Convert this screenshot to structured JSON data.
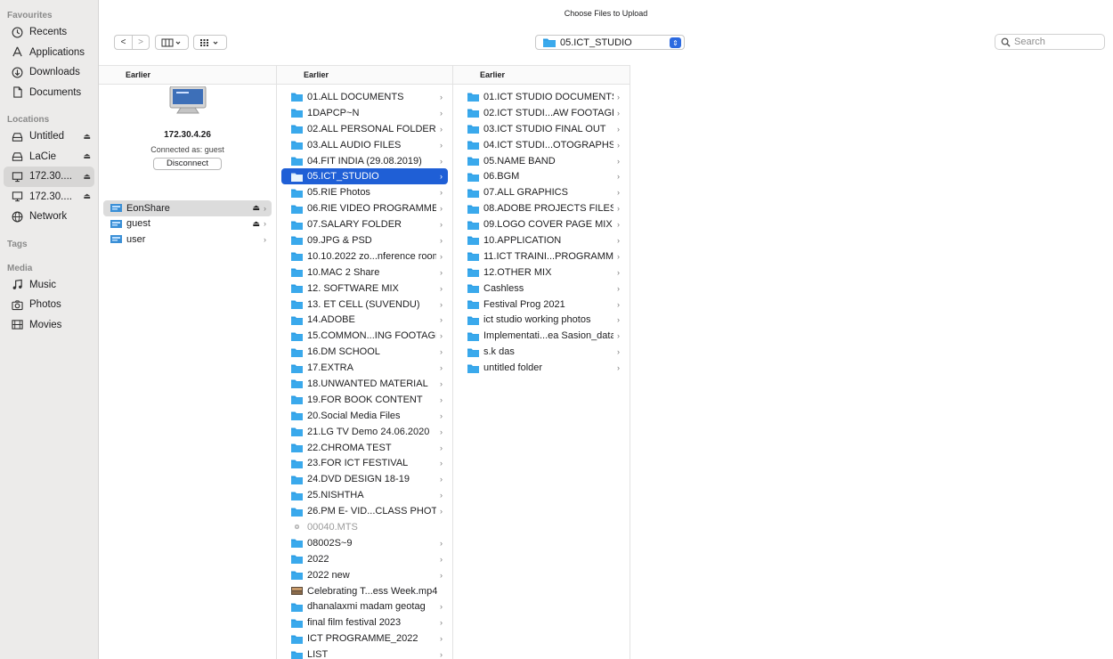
{
  "window": {
    "title": "Choose Files to Upload"
  },
  "sidebar": {
    "favourites_heading": "Favourites",
    "favourites": [
      {
        "label": "Recents",
        "icon": "clock-icon"
      },
      {
        "label": "Applications",
        "icon": "applications-icon"
      },
      {
        "label": "Downloads",
        "icon": "download-icon"
      },
      {
        "label": "Documents",
        "icon": "document-icon"
      }
    ],
    "locations_heading": "Locations",
    "locations": [
      {
        "label": "Untitled",
        "icon": "drive-icon",
        "eject": "⏏"
      },
      {
        "label": "LaCie",
        "icon": "drive-icon",
        "eject": "⏏"
      },
      {
        "label": "172.30....",
        "icon": "server-icon",
        "eject": "⏏",
        "selected": true
      },
      {
        "label": "172.30....",
        "icon": "server-icon",
        "eject": "⏏"
      },
      {
        "label": "Network",
        "icon": "network-icon"
      }
    ],
    "tags_heading": "Tags",
    "media_heading": "Media",
    "media": [
      {
        "label": "Music",
        "icon": "music-icon"
      },
      {
        "label": "Photos",
        "icon": "camera-icon"
      },
      {
        "label": "Movies",
        "icon": "film-icon"
      }
    ]
  },
  "toolbar": {
    "back": "<",
    "forward": ">",
    "view_icon": "columns-view-icon",
    "arrange_icon": "grid-arrange-icon",
    "path": "05.ICT_STUDIO",
    "search_placeholder": "Search"
  },
  "columns": {
    "header": "Earlier",
    "server": {
      "name": "172.30.4.26",
      "connected": "Connected as: guest",
      "disconnect": "Disconnect"
    },
    "shares": [
      {
        "name": "EonShare",
        "eject": "⏏",
        "chev": "›",
        "active": true
      },
      {
        "name": "guest",
        "eject": "⏏",
        "chev": "›"
      },
      {
        "name": "user",
        "chev": "›"
      }
    ],
    "col2": [
      {
        "name": "01.ALL DOCUMENTS",
        "chev": "›"
      },
      {
        "name": "1DAPCP~N",
        "chev": "›"
      },
      {
        "name": "02.ALL PERSONAL FOLDER",
        "chev": "›"
      },
      {
        "name": "03.ALL AUDIO FILES",
        "chev": "›"
      },
      {
        "name": "04.FIT INDIA (29.08.2019)",
        "chev": "›"
      },
      {
        "name": "05.ICT_STUDIO",
        "chev": "›",
        "selected": true
      },
      {
        "name": "05.RIE Photos",
        "chev": "›"
      },
      {
        "name": "06.RIE VIDEO PROGRAMME",
        "chev": "›"
      },
      {
        "name": "07.SALARY FOLDER",
        "chev": "›"
      },
      {
        "name": "09.JPG & PSD",
        "chev": "›"
      },
      {
        "name": "10.10.2022 zo...nference room",
        "chev": "›"
      },
      {
        "name": "10.MAC 2 Share",
        "chev": "›"
      },
      {
        "name": "12. SOFTWARE MIX",
        "chev": "›"
      },
      {
        "name": "13. ET CELL (SUVENDU)",
        "chev": "›"
      },
      {
        "name": "14.ADOBE",
        "chev": "›"
      },
      {
        "name": "15.COMMON...ING FOOTAGE",
        "chev": "›"
      },
      {
        "name": "16.DM SCHOOL",
        "chev": "›"
      },
      {
        "name": "17.EXTRA",
        "chev": "›"
      },
      {
        "name": "18.UNWANTED MATERIAL",
        "chev": "›"
      },
      {
        "name": "19.FOR BOOK CONTENT",
        "chev": "›"
      },
      {
        "name": "20.Social Media Files",
        "chev": "›"
      },
      {
        "name": "21.LG TV Demo 24.06.2020",
        "chev": "›"
      },
      {
        "name": "22.CHROMA TEST",
        "chev": "›"
      },
      {
        "name": "23.FOR ICT FESTIVAL",
        "chev": "›"
      },
      {
        "name": "24.DVD DESIGN 18-19",
        "chev": "›"
      },
      {
        "name": "25.NISHTHA",
        "chev": "›"
      },
      {
        "name": "26.PM E- VID...CLASS PHOTO",
        "chev": "›"
      },
      {
        "name": "00040.MTS",
        "chev": "",
        "kind": "file",
        "dim": true
      },
      {
        "name": "08002S~9",
        "chev": "›"
      },
      {
        "name": "2022",
        "chev": "›"
      },
      {
        "name": "2022 new",
        "chev": "›"
      },
      {
        "name": "Celebrating T...ess Week.mp4",
        "chev": "",
        "kind": "video"
      },
      {
        "name": "dhanalaxmi madam geotag",
        "chev": "›"
      },
      {
        "name": "final film festival 2023",
        "chev": "›"
      },
      {
        "name": "ICT PROGRAMME_2022",
        "chev": "›"
      },
      {
        "name": "LIST",
        "chev": "›"
      }
    ],
    "col3": [
      {
        "name": "01.ICT STUDIO DOCUMENTS",
        "chev": "›"
      },
      {
        "name": "02.ICT STUDI...AW FOOTAGE",
        "chev": "›"
      },
      {
        "name": "03.ICT STUDIO FINAL OUT",
        "chev": "›"
      },
      {
        "name": "04.ICT STUDI...OTOGRAPHS",
        "chev": "›"
      },
      {
        "name": "05.NAME BAND",
        "chev": "›"
      },
      {
        "name": "06.BGM",
        "chev": "›"
      },
      {
        "name": "07.ALL GRAPHICS",
        "chev": "›"
      },
      {
        "name": "08.ADOBE PROJECTS FILES",
        "chev": "›"
      },
      {
        "name": "09.LOGO COVER PAGE MIX",
        "chev": "›"
      },
      {
        "name": "10.APPLICATION",
        "chev": "›"
      },
      {
        "name": "11.ICT TRAINI...PROGRAMME",
        "chev": "›"
      },
      {
        "name": "12.OTHER MIX",
        "chev": "›"
      },
      {
        "name": "Cashless",
        "chev": "›"
      },
      {
        "name": "Festival Prog 2021",
        "chev": "›"
      },
      {
        "name": "ict studio working photos",
        "chev": "›"
      },
      {
        "name": "Implementati...ea Sasion_data",
        "chev": "›"
      },
      {
        "name": "s.k das",
        "chev": "›"
      },
      {
        "name": "untitled folder",
        "chev": "›"
      }
    ]
  },
  "colors": {
    "selection": "#1f5fd6",
    "folder": "#2a9be3",
    "sidebar_bg": "#ecebea"
  }
}
